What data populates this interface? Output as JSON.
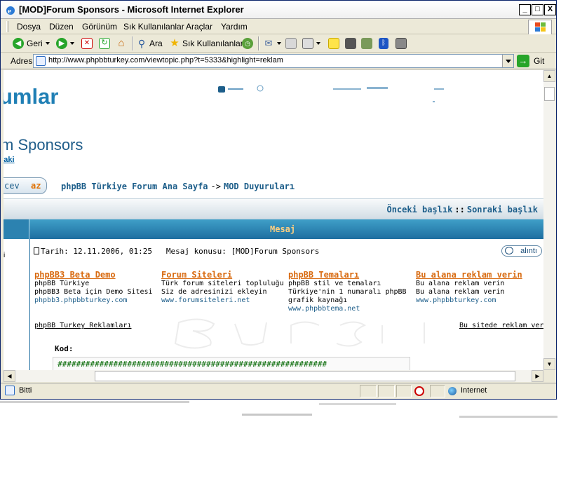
{
  "window": {
    "title": "[MOD]Forum Sponsors - Microsoft Internet Explorer",
    "min": "_",
    "max": "□",
    "close": "X"
  },
  "menu": [
    "Dosya",
    "Düzen",
    "Görünüm",
    "Sık Kullanılanlar",
    "Araçlar",
    "Yardım"
  ],
  "toolbar": {
    "back": "Geri",
    "search": "Ara",
    "favorites": "Sık Kullanılanlar"
  },
  "address": {
    "label": "Adres",
    "url": "http://www.phpbbturkey.com/viewtopic.php?t=5333&highlight=reklam",
    "go": "Git"
  },
  "page": {
    "logo": "umlar",
    "forum_title": "m Sponsors",
    "subtitle_link": "raki",
    "reply_button_left": "cev",
    "reply_button_right": "az",
    "breadcrumb_home": "phpBB Türkiye Forum Ana Sayfa",
    "breadcrumb_sep": "->",
    "breadcrumb_forum": "MOD Duyuruları",
    "prev_topic": "Önceki başlık",
    "nav_sep": "::",
    "next_topic": "Sonraki başlık",
    "table_header": "Mesaj",
    "left_col_text": "i",
    "post_date_label": "Tarih: 12.11.2006, 01:25",
    "post_subject": "Mesaj konusu: [MOD]Forum Sponsors",
    "quote_button": "alıntı",
    "ads": [
      {
        "title": "phpBB3 Beta Demo",
        "line1": "phpBB Türkiye",
        "line2": "phpBB3 Beta için Demo Sitesi",
        "line3": "",
        "url": "phpbb3.phpbbturkey.com"
      },
      {
        "title": "Forum Siteleri",
        "line1": "Türk forum siteleri topluluğu",
        "line2": "Siz de adresinizi ekleyin",
        "line3": "",
        "url": "www.forumsiteleri.net"
      },
      {
        "title": "phpBB Temaları",
        "line1": "phpBB stil ve temaları",
        "line2": "Türkiye'nin 1 numaralı phpBB",
        "line3": "grafik kaynağı",
        "url": "www.phpbbtema.net"
      },
      {
        "title": "Bu alana reklam verin",
        "line1": "Bu alana reklam verin",
        "line2": "Bu alana reklam verin",
        "line3": "",
        "url": "www.phpbbturkey.com"
      }
    ],
    "ads_footer_left": "phpBB Turkey Reklamları",
    "ads_footer_right": "Bu sitede reklam ver",
    "code_label": "Kod:",
    "code_content": "##########################################################"
  },
  "status": {
    "text": "Bitti",
    "zone": "Internet"
  }
}
